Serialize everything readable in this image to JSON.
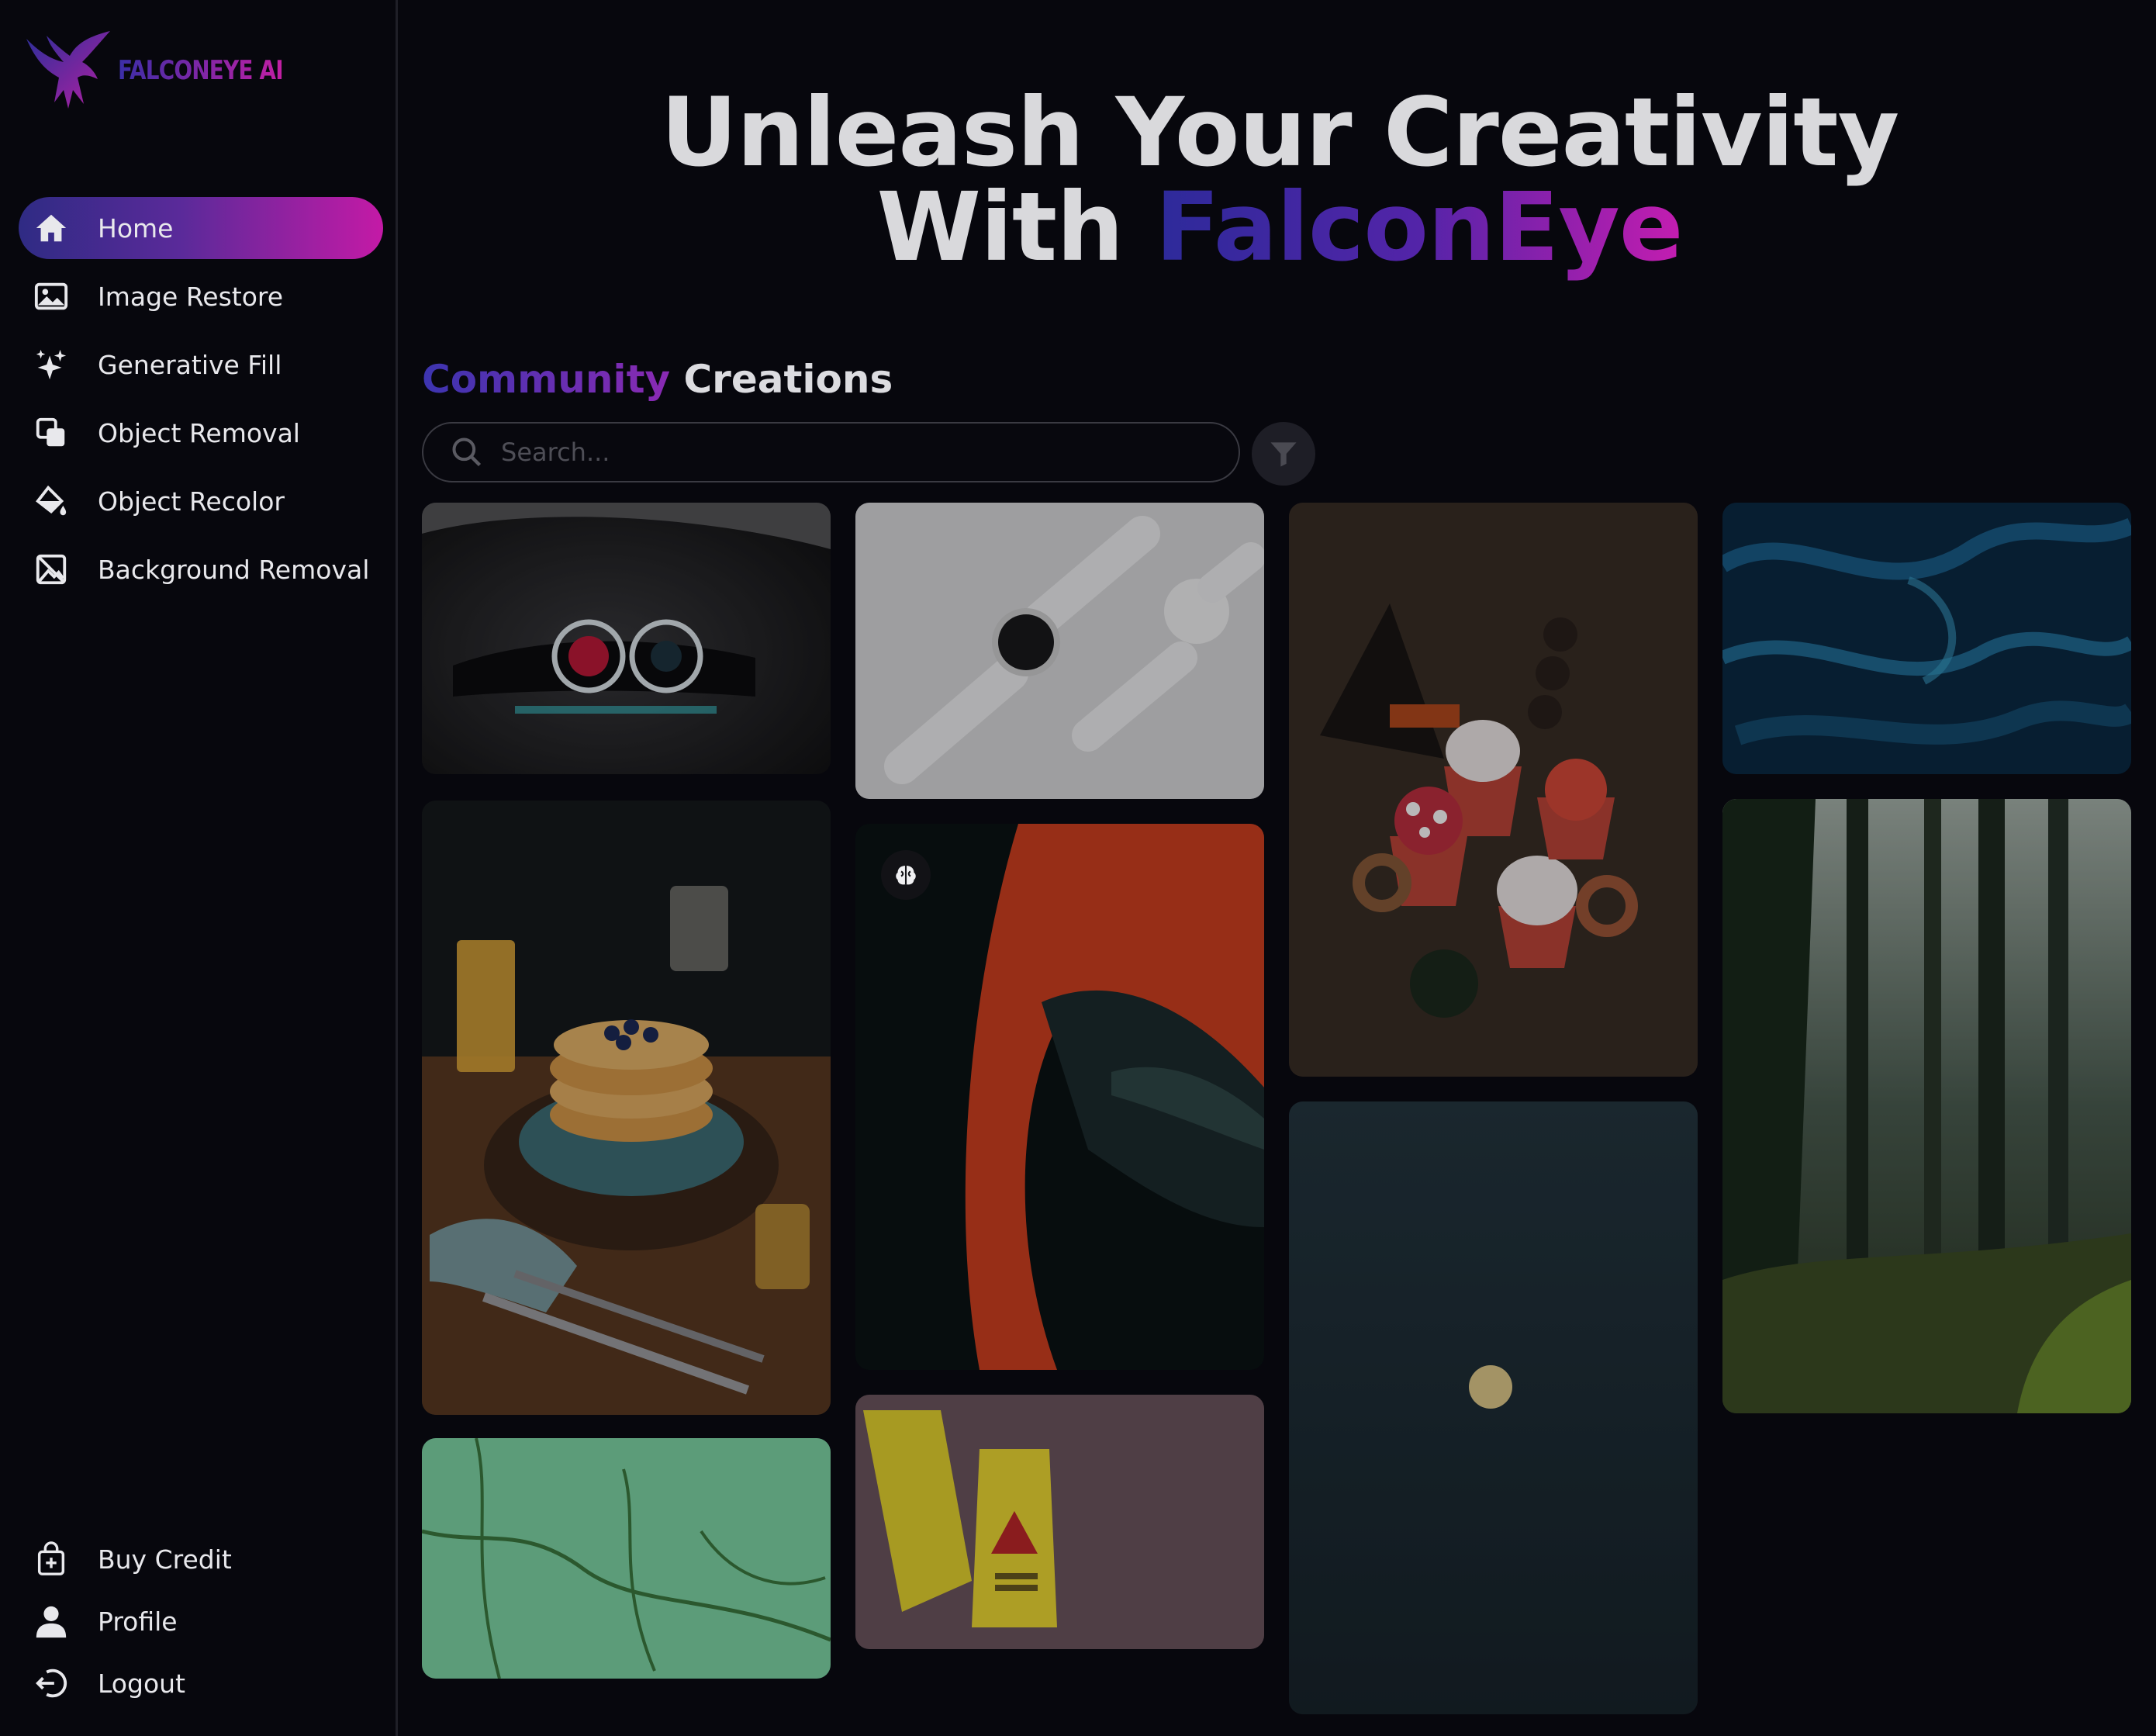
{
  "app": {
    "logo_text": "FALCONEYE AI"
  },
  "sidebar": {
    "items": [
      {
        "label": "Home",
        "icon": "home-icon",
        "active": true
      },
      {
        "label": "Image Restore",
        "icon": "image-icon"
      },
      {
        "label": "Generative Fill",
        "icon": "sparkles-icon"
      },
      {
        "label": "Object Removal",
        "icon": "layers-icon"
      },
      {
        "label": "Object Recolor",
        "icon": "paint-bucket-icon"
      },
      {
        "label": "Background Removal",
        "icon": "image-off-icon"
      }
    ],
    "bottom": [
      {
        "label": "Buy Credit",
        "icon": "shopping-bag-icon"
      },
      {
        "label": "Profile",
        "icon": "user-icon"
      },
      {
        "label": "Logout",
        "icon": "logout-icon"
      }
    ]
  },
  "hero": {
    "line1": "Unleash Your Creativity",
    "line2_prefix": "With ",
    "line2_brand": "FalconEye"
  },
  "section": {
    "title_accent": "Community",
    "title_rest": " Creations"
  },
  "search": {
    "placeholder": "Search...",
    "value": ""
  },
  "colors": {
    "accent_start": "#2f2b84",
    "accent_end": "#c41aa6",
    "background": "#07070d"
  },
  "gallery": {
    "items": [
      {
        "subject": "car-headlights"
      },
      {
        "subject": "smartwatches"
      },
      {
        "subject": "halloween-treats"
      },
      {
        "subject": "blue-abstract"
      },
      {
        "subject": "pancakes"
      },
      {
        "subject": "red-car-detail"
      },
      {
        "subject": "forest"
      },
      {
        "subject": "green-wall-vines"
      },
      {
        "subject": "caution-signs"
      },
      {
        "subject": "moon-night"
      }
    ]
  }
}
